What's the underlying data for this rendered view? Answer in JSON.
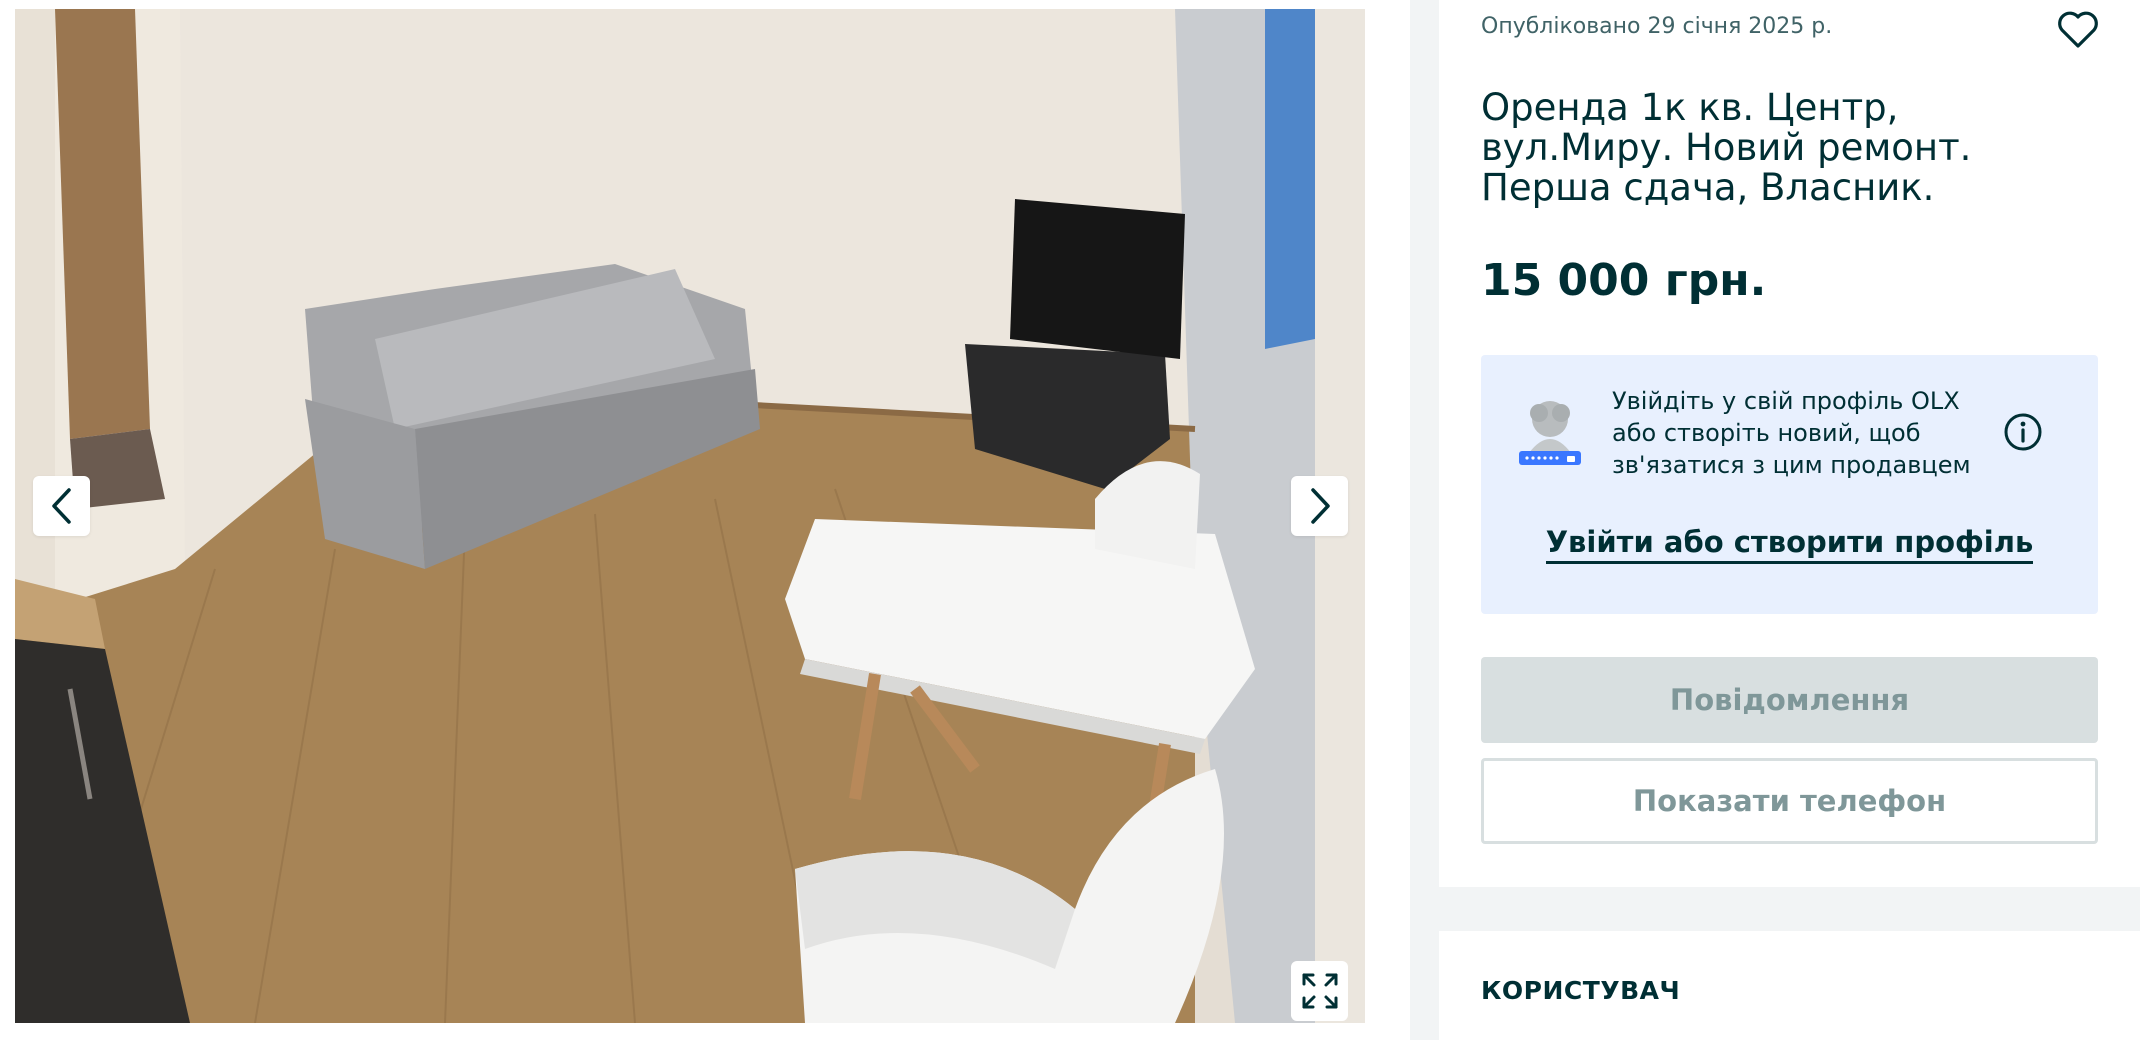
{
  "gallery": {
    "photo_alt": "Apartment living room with grey sofa, TV, white table and chairs",
    "prev_icon": "chevron-left-icon",
    "next_icon": "chevron-right-icon",
    "fullscreen_icon": "expand-icon"
  },
  "ad": {
    "published": "Опубліковано 29 січня 2025 р.",
    "favorite_icon": "heart-icon",
    "title": "Оренда 1к кв. Центр, вул.Миру. Новий ремонт. Перша сдача, Власник.",
    "price": "15 000 грн."
  },
  "login_prompt": {
    "text": "Увійдіть у свій профіль OLX або створіть новий, щоб зв'язатися з цим продавцем",
    "info_icon": "info-icon",
    "link_label": "Увійти або створити профіль"
  },
  "actions": {
    "message_label": "Повідомлення",
    "phone_label": "Показати телефон"
  },
  "user_section": {
    "heading": "КОРИСТУВАЧ"
  },
  "colors": {
    "text_primary": "#002f34",
    "login_box_bg": "#e8f0fe",
    "disabled_button_bg": "#d8dfe0",
    "disabled_text": "#7f9799"
  }
}
